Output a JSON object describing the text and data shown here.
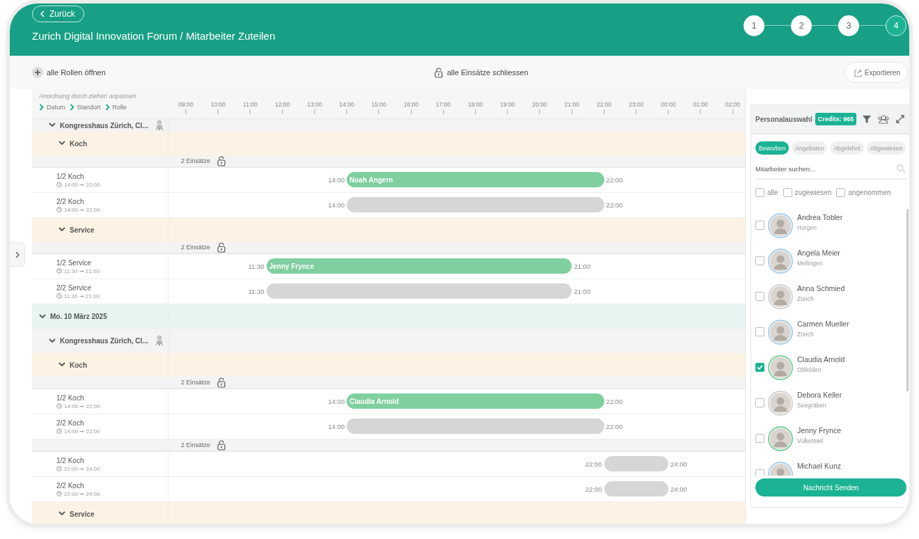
{
  "header": {
    "back_button": "Zurück",
    "title": "Zurich Digital Innovation Forum / Mitarbeiter Zuteilen",
    "steps": [
      {
        "label": "1",
        "selected": false
      },
      {
        "label": "2",
        "selected": false
      },
      {
        "label": "3",
        "selected": false
      },
      {
        "label": "4",
        "selected": true
      }
    ]
  },
  "toolbar": {
    "expand_all": "alle Rollen öffnen",
    "lock_all": "alle Einsätze schliessen",
    "export_button": "Exportieren"
  },
  "schedule": {
    "hint": "Anordnung durch ziehen anpassen",
    "sort_levels": [
      "Datum",
      "Standort",
      "Rolle"
    ],
    "hours": [
      "09:00",
      "10:00",
      "11:00",
      "12:00",
      "13:00",
      "14:00",
      "15:00",
      "16:00",
      "17:00",
      "18:00",
      "19:00",
      "20:00",
      "21:00",
      "22:00",
      "23:00",
      "00:00",
      "01:00",
      "02:00"
    ],
    "tree": [
      {
        "kind": "location",
        "label": "Kongresshaus Zürich, Cl...",
        "expanded": true,
        "children": [
          {
            "kind": "role",
            "label": "Koch",
            "expanded": true,
            "children": [
              {
                "kind": "group",
                "count": "2 Einsätze",
                "children": [
                  {
                    "kind": "shift",
                    "label": "1/2 Koch",
                    "time": "14:00 ➞ 22:00",
                    "start": "14:00",
                    "end": "22:00",
                    "assignee": "Noah Angern"
                  },
                  {
                    "kind": "shift",
                    "label": "2/2 Koch",
                    "time": "14:00 ➞ 22:00",
                    "start": "14:00",
                    "end": "22:00"
                  }
                ]
              }
            ]
          },
          {
            "kind": "role",
            "label": "Service",
            "expanded": true,
            "children": [
              {
                "kind": "group",
                "count": "2 Einsätze",
                "children": [
                  {
                    "kind": "shift",
                    "label": "1/2 Service",
                    "time": "11:30 ➞ 21:00",
                    "start": "11:30",
                    "end": "21:00",
                    "assignee": "Jenny Frynce"
                  },
                  {
                    "kind": "shift",
                    "label": "2/2 Service",
                    "time": "11:30 ➞ 21:00",
                    "start": "11:30",
                    "end": "21:00"
                  }
                ]
              }
            ]
          }
        ]
      },
      {
        "kind": "date",
        "label": "Mo. 10 März 2025",
        "expanded": true,
        "children": [
          {
            "kind": "location",
            "label": "Kongresshaus Zürich, Cl...",
            "expanded": true,
            "children": [
              {
                "kind": "role",
                "label": "Koch",
                "expanded": true,
                "children": [
                  {
                    "kind": "group",
                    "count": "2 Einsätze",
                    "children": [
                      {
                        "kind": "shift",
                        "label": "1/2 Koch",
                        "time": "14:00 ➞ 22:00",
                        "start": "14:00",
                        "end": "22:00",
                        "assignee": "Claudia Arnold"
                      },
                      {
                        "kind": "shift",
                        "label": "2/2 Koch",
                        "time": "14:00 ➞ 22:00",
                        "start": "14:00",
                        "end": "22:00"
                      }
                    ]
                  },
                  {
                    "kind": "group",
                    "count": "2 Einsätze",
                    "children": [
                      {
                        "kind": "shift",
                        "label": "1/2 Koch",
                        "time": "22:00 ➞ 24:00",
                        "start": "22:00",
                        "end": "24:00"
                      },
                      {
                        "kind": "shift",
                        "label": "2/2 Koch",
                        "time": "22:00 ➞ 24:00",
                        "start": "22:00",
                        "end": "24:00"
                      }
                    ]
                  }
                ]
              },
              {
                "kind": "role",
                "label": "Service",
                "expanded": true
              }
            ]
          }
        ]
      }
    ]
  },
  "staff_panel": {
    "title": "Personalauswahl",
    "credits": "Credits: 965",
    "filters": [
      {
        "label": "Beworben",
        "selected": true
      },
      {
        "label": "Angeboten",
        "selected": false
      },
      {
        "label": "Abgelehnt",
        "selected": false
      },
      {
        "label": "Abgewiesen",
        "selected": false
      }
    ],
    "search": {
      "placeholder": "Mitarbeiter suchen..."
    },
    "options": [
      {
        "label": "alle",
        "checked": false
      },
      {
        "label": "zugewiesen",
        "checked": false
      },
      {
        "label": "angenommen",
        "checked": false
      }
    ],
    "people": [
      {
        "name": "Andrea Tobler",
        "place": "Horgen",
        "checked": false,
        "color": "#a9cfea"
      },
      {
        "name": "Angela Meier",
        "place": "Mellingen",
        "checked": false,
        "color": "#a9cfea"
      },
      {
        "name": "Anna Schmied",
        "place": "Zürich",
        "checked": false,
        "color": "#d3d3d3"
      },
      {
        "name": "Carmen Mueller",
        "place": "Zürich",
        "checked": false,
        "color": "#a9cfea"
      },
      {
        "name": "Claudia Arnold",
        "place": "Obfelden",
        "checked": true,
        "color": "#7fd0a0"
      },
      {
        "name": "Debora Keller",
        "place": "Seegräben",
        "checked": false,
        "color": "#d3d3d3"
      },
      {
        "name": "Jenny Frynce",
        "place": "Volketswil",
        "checked": false,
        "color": "#7fd0a0"
      },
      {
        "name": "Michael Kunz",
        "checked": false,
        "color": "#a9cfea"
      }
    ],
    "send_button": "Nachricht Senden"
  }
}
